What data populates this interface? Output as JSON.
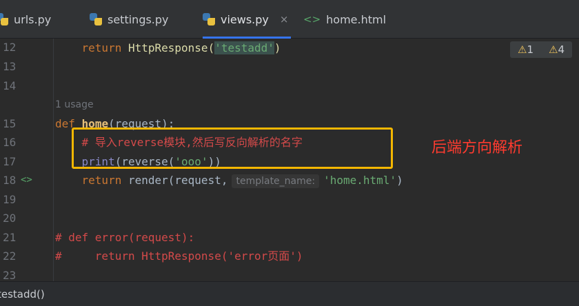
{
  "tabs": [
    {
      "label": "urls.py",
      "icon": "python-icon"
    },
    {
      "label": "settings.py",
      "icon": "python-icon"
    },
    {
      "label": "views.py",
      "icon": "python-icon",
      "active": true,
      "close": "×"
    },
    {
      "label": "home.html",
      "icon": "html-icon",
      "icon_glyph": "<>"
    }
  ],
  "warnings": {
    "count_a": "1",
    "count_b": "4"
  },
  "gutter": {
    "lines": [
      "12",
      "13",
      "14",
      "15",
      "16",
      "17",
      "18",
      "19",
      "20",
      "21",
      "22",
      "23"
    ],
    "mark_18": "<>"
  },
  "code": {
    "l12_kw": "return",
    "l12_call": "HttpResponse(",
    "l12_str": "'testadd'",
    "l12_close": ")",
    "usage": "1 usage",
    "l15_def": "def",
    "l15_name": "home",
    "l15_rest": "(request):",
    "l16_comment": "# 导入reverse模块,然后写反向解析的名字",
    "l17_print": "print",
    "l17_mid": "(reverse(",
    "l17_str": "'ooo'",
    "l17_close": "))",
    "l18_kw": "return",
    "l18_call": "render(request,",
    "l18_hint": "template_name:",
    "l18_str": "'home.html'",
    "l18_close": ")",
    "l21": "# def error(request):",
    "l22": "#     return HttpResponse('error页面')"
  },
  "annotation": "后端方向解析",
  "status": {
    "breadcrumb": "testadd()"
  },
  "colors": {
    "accent": "#3574f0",
    "annotation_box": "#f5b700",
    "annotation_text": "#ff3b2f"
  }
}
